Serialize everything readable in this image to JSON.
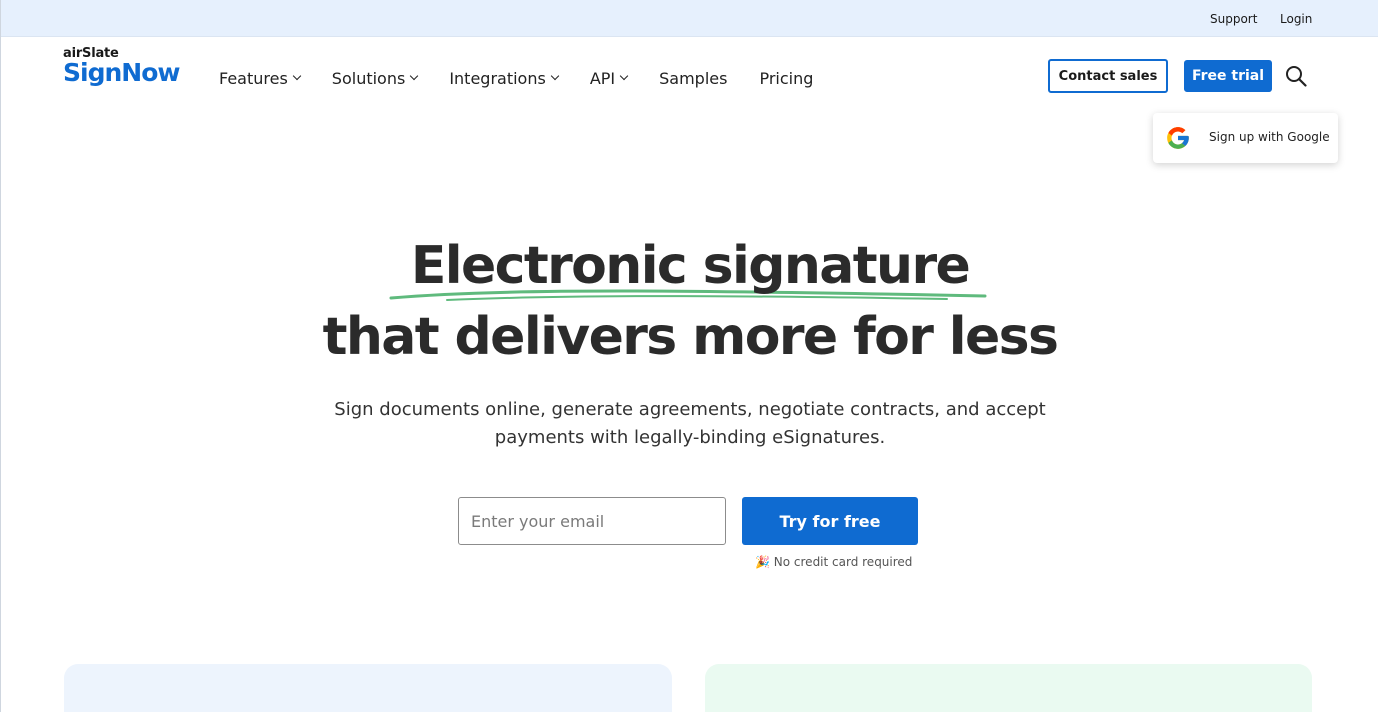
{
  "topbar": {
    "support": "Support",
    "login": "Login"
  },
  "brand": {
    "line1": "airSlate",
    "line2": "SignNow",
    "color": "#0f6bd1"
  },
  "nav": {
    "items": [
      {
        "label": "Features",
        "dropdown": true
      },
      {
        "label": "Solutions",
        "dropdown": true
      },
      {
        "label": "Integrations",
        "dropdown": true
      },
      {
        "label": "API",
        "dropdown": true
      },
      {
        "label": "Samples",
        "dropdown": false
      },
      {
        "label": "Pricing",
        "dropdown": false
      }
    ]
  },
  "header": {
    "contact_sales": "Contact sales",
    "free_trial": "Free trial",
    "search_icon": "search-icon"
  },
  "google_popup": {
    "label": "Sign up with Google",
    "icon": "google-icon"
  },
  "hero": {
    "line1": "Electronic signature",
    "line2": "that delivers more for less",
    "subtitle": "Sign documents online, generate agreements, negotiate contracts, and accept payments with legally-binding eSignatures.",
    "accent_underline": "#5fba7d"
  },
  "signup": {
    "email_placeholder": "Enter your email",
    "email_value": "",
    "button": "Try for free",
    "note_emoji": "🎉",
    "note": "No credit card required"
  },
  "colors": {
    "primary": "#0f6bd1",
    "topbar_bg": "#e6f0fd",
    "card_left": "#edf4fd",
    "card_right": "#eafaf1"
  }
}
